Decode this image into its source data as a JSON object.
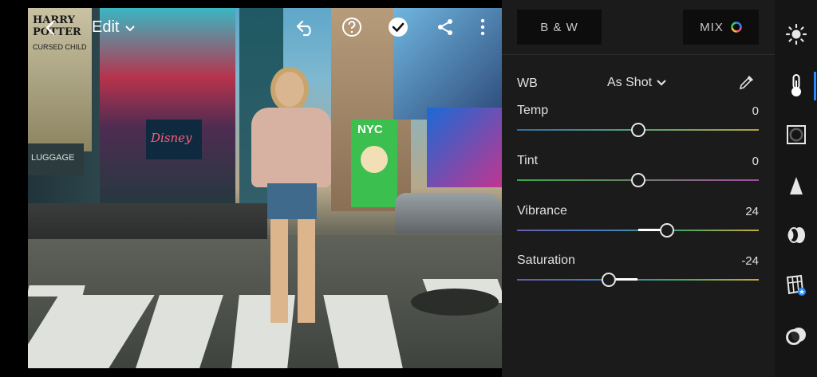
{
  "header": {
    "edit_label": "Edit"
  },
  "panel": {
    "bw_label": "B & W",
    "mix_label": "MIX",
    "wb_label": "WB",
    "wb_value": "As Shot",
    "sliders": [
      {
        "label": "Temp",
        "value": "0",
        "position": 0.5
      },
      {
        "label": "Tint",
        "value": "0",
        "position": 0.5
      },
      {
        "label": "Vibrance",
        "value": "24",
        "position": 0.62
      },
      {
        "label": "Saturation",
        "value": "-24",
        "position": 0.38
      }
    ]
  },
  "photo": {
    "billboard_nyc": "NYC",
    "billboard_harry_potter": "HARRY POTTER",
    "billboard_cursed_child": "CURSED CHILD",
    "billboard_luggage": "LUGGAGE",
    "billboard_disney": "Disney"
  },
  "toolbar": {
    "icons": [
      "light-icon",
      "color-icon",
      "effects-icon",
      "detail-icon",
      "optics-icon",
      "geometry-icon",
      "presets-icon"
    ],
    "active_index": 1
  },
  "colors": {
    "accent": "#2b8cff",
    "panel_bg": "#1b1b1b",
    "toolbar_bg": "#151515"
  }
}
